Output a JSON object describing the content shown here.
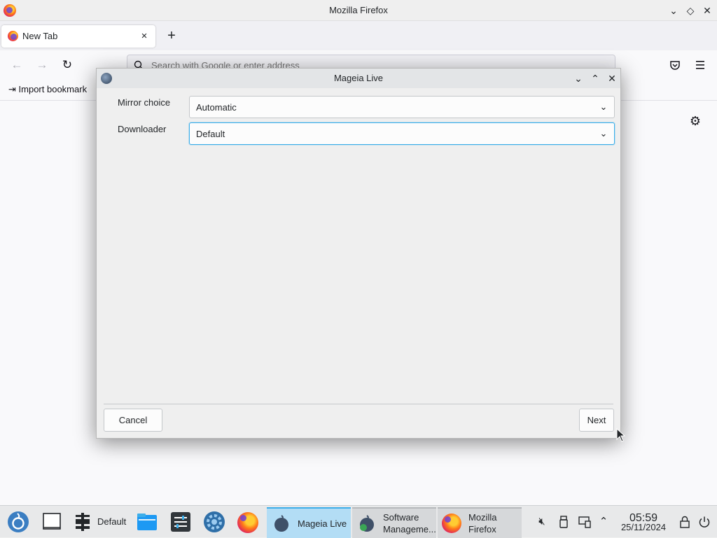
{
  "firefox": {
    "window_title": "Mozilla Firefox",
    "tab_label": "New Tab",
    "tab_close": "×",
    "new_tab": "+",
    "url_placeholder": "Search with Google or enter address",
    "import_bookmarks": "Import bookmark",
    "colors": {
      "chrome": "#f0f0f4",
      "content": "#f9f9fb"
    }
  },
  "dialog": {
    "title": "Mageia Live",
    "fields": [
      {
        "label": "Mirror choice",
        "value": "Automatic"
      },
      {
        "label": "Downloader",
        "value": "Default"
      }
    ],
    "cancel_label": "Cancel",
    "next_label": "Next",
    "focus_color": "#3daee9"
  },
  "taskbar": {
    "desktop_label": "Default",
    "tasks": [
      {
        "label": "Mageia Live",
        "state": "active"
      },
      {
        "label_line1": "Software",
        "label_line2": "Manageme...",
        "state": "inactive"
      },
      {
        "label_line1": "Mozilla",
        "label_line2": "Firefox",
        "state": "inactive"
      }
    ],
    "clock": {
      "time": "05:59",
      "date": "25/11/2024"
    },
    "icons": [
      "mageia-menu-icon",
      "show-desktop-icon",
      "pager-icon",
      "files-icon",
      "settings-app-icon",
      "mageia-control-center-icon",
      "firefox-icon",
      "mute-icon",
      "usb-icon",
      "network-icon",
      "tray-expand-icon",
      "lock-icon",
      "power-icon"
    ]
  }
}
